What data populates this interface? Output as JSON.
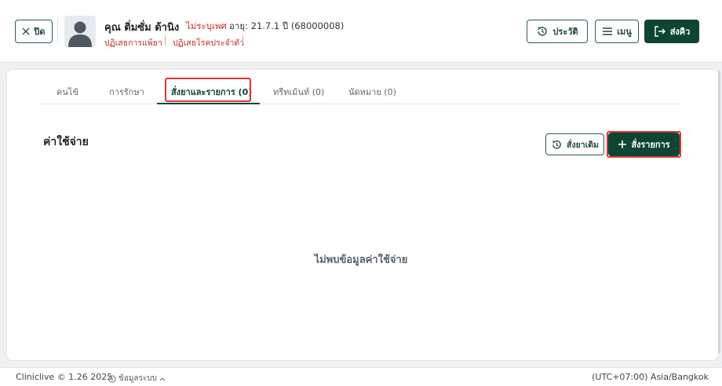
{
  "header": {
    "close_label": "ปิด",
    "patient_name": "คุณ ติ่มซั่ม ต้านิง",
    "gender": "ไม่ระบุเพศ",
    "age": "อายุ: 21.7.1 ปี  (68000008)",
    "drug_allergy": "ปฏิเสธการแพ้ยา",
    "chronic_disease": "ปฏิเสธโรคประจำตัว",
    "history_label": "ประวัติ",
    "menu_label": "เมนู",
    "send_label": "ส่งคิว"
  },
  "tabs": [
    {
      "label": "คนไข้"
    },
    {
      "label": "การรักษา"
    },
    {
      "label": "สั่งยาและรายการ (0)"
    },
    {
      "label": "ทรีทเม้นท์ (0)"
    },
    {
      "label": "นัดหมาย (0)"
    }
  ],
  "main": {
    "section_title": "ค่าใช้จ่าย",
    "order_old_label": "สั่งยาเดิม",
    "order_label": "สั่งรายการ",
    "empty_message": "ไม่พบข้อมูลค่าใช้จ่าย"
  },
  "footer": {
    "app_version": "Cliniclive © 1.26 2025",
    "system_info": "ข้อมูลระบบ",
    "timezone": "(UTC+07:00) Asia/Bangkok"
  },
  "colors": {
    "brand": "#0e4532",
    "danger": "#c62828",
    "highlight": "#d93636"
  }
}
